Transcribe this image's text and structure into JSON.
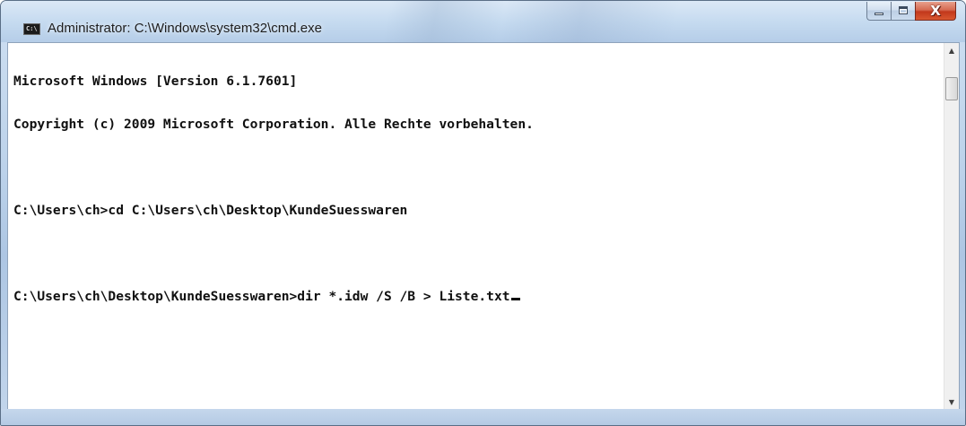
{
  "window": {
    "title": "Administrator: C:\\Windows\\system32\\cmd.exe",
    "icon": "cmd-icon",
    "icon_text": "C:\\",
    "buttons": {
      "minimize": "minimize-icon",
      "maximize": "maximize-icon",
      "close": "close-icon",
      "close_glyph": "X"
    }
  },
  "console": {
    "lines": [
      "Microsoft Windows [Version 6.1.7601]",
      "Copyright (c) 2009 Microsoft Corporation. Alle Rechte vorbehalten.",
      "",
      "C:\\Users\\ch>cd C:\\Users\\ch\\Desktop\\KundeSuesswaren",
      "",
      "C:\\Users\\ch\\Desktop\\KundeSuesswaren>dir *.idw /S /B > Liste.txt"
    ],
    "cursor": "_"
  },
  "scrollbar": {
    "up_arrow": "▲",
    "down_arrow": "▼"
  },
  "colors": {
    "console_background": "#ffffff",
    "console_text": "#101010",
    "close_button": "#c2381c"
  }
}
